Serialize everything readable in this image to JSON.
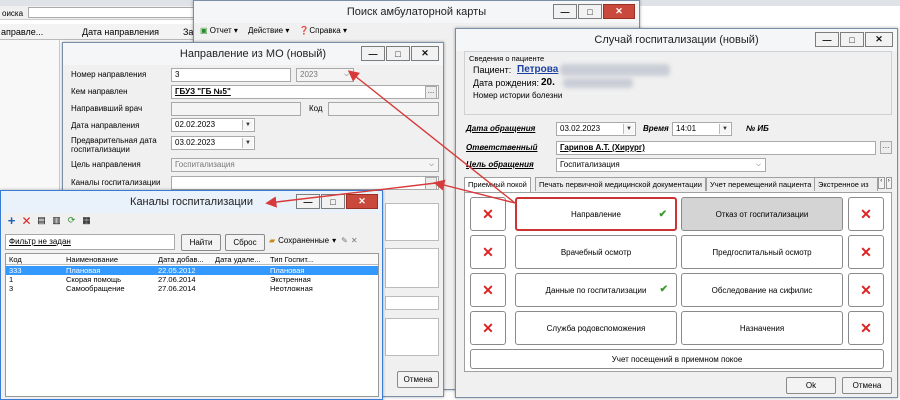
{
  "background_app": {
    "search_label": "оиска",
    "columns": [
      "аправле...",
      "Дата направления",
      "За"
    ]
  },
  "search_card_window": {
    "title": "Поиск амбулаторной карты",
    "menu": {
      "report": "Отчет",
      "action": "Действие",
      "help": "Справка"
    }
  },
  "referral_window": {
    "title": "Направление из МО (новый)",
    "labels": {
      "number": "Номер направления",
      "from": "Кем направлен",
      "doctor": "Направивший врач",
      "code": "Код",
      "date": "Дата направления",
      "prelim_date": "Предварительная дата госпитализации",
      "goal": "Цель направления",
      "channels": "Каналы госпитализации"
    },
    "values": {
      "number": "3",
      "year": "2023",
      "from": "ГБУЗ \"ГБ №5\"",
      "date": "02.02.2023",
      "prelim_date": "03.02.2023",
      "goal": "Госпитализация"
    },
    "cancel": "Отмена"
  },
  "channels_window": {
    "title": "Каналы госпитализации",
    "filter_text": "Фильтр не задан",
    "find_button": "Найти",
    "reset_button": "Сброс",
    "saved_button": "Сохраненные",
    "columns": [
      "Код",
      "Наименование",
      "Дата добав...",
      "Дата удале...",
      "Тип Госпит..."
    ],
    "rows": [
      {
        "code": "333",
        "name": "Плановая",
        "added": "22.05.2012",
        "deleted": "",
        "type": "Плановая"
      },
      {
        "code": "1",
        "name": "Скорая помощь",
        "added": "27.06.2014",
        "deleted": "",
        "type": "Экстренная"
      },
      {
        "code": "3",
        "name": "Самообращение",
        "added": "27.06.2014",
        "deleted": "",
        "type": "Неотложная"
      }
    ]
  },
  "hospitalization_window": {
    "title": "Случай госпитализации (новый)",
    "patient_group": "Сведения о пациенте",
    "patient_label": "Пациент:",
    "patient_name": "Петрова",
    "dob_label": "Дата рождения:",
    "dob_value": "20.",
    "history_label": "Номер истории болезни",
    "fields": {
      "visit_date_label": "Дата обращения",
      "visit_date": "03.02.2023",
      "time_label": "Время",
      "time": "14:01",
      "ib_label": "№ ИБ",
      "responsible_label": "Ответственный",
      "responsible": "Гарипов А.Т. (Хирург)",
      "goal_label": "Цель обращения",
      "goal": "Госпитализация"
    },
    "tabs": [
      "Приемный покой",
      "Печать первичной медицинской документации",
      "Учет перемещений пациента",
      "Экстренное из"
    ],
    "buttons": {
      "referral": "Направление",
      "refusal": "Отказ от госпитализации",
      "doctor_exam": "Врачебный осмотр",
      "preop_exam": "Предгоспитальный осмотр",
      "hosp_data": "Данные по госпитализации",
      "syphilis": "Обследование на сифилис",
      "obstetric": "Служба родовспоможения",
      "prescriptions": "Назначения",
      "visits": "Учет посещений в приемном покое"
    },
    "ok": "Ok",
    "cancel": "Отмена"
  },
  "colors": {
    "arrow": "#d63a3a",
    "accent_blue": "#1a5fb4",
    "highlight": "#3399ff"
  }
}
